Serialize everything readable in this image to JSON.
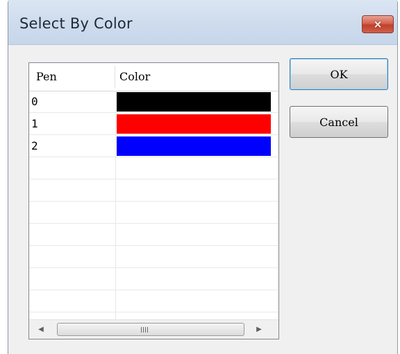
{
  "window": {
    "title": "Select By Color",
    "close_label": "×"
  },
  "table": {
    "headers": [
      "Pen",
      "Color"
    ],
    "rows": [
      {
        "pen": "0",
        "color": "#000000"
      },
      {
        "pen": "1",
        "color": "#ff0000"
      },
      {
        "pen": "2",
        "color": "#0000ff"
      }
    ],
    "empty_rows": 8
  },
  "scrollbar": {
    "left_icon": "arrow-left-icon",
    "right_icon": "arrow-right-icon"
  },
  "buttons": {
    "ok_label": "OK",
    "cancel_label": "Cancel"
  }
}
